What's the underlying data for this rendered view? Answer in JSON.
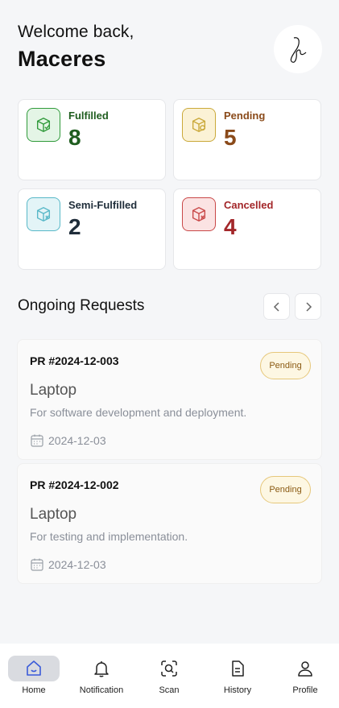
{
  "header": {
    "greeting": "Welcome back,",
    "user_name": "Maceres"
  },
  "stats": [
    {
      "label": "Fulfilled",
      "value": "8",
      "color": "#1f5d1f",
      "icon": "box-check-icon",
      "accent": "#2f9a3a",
      "bg": "#e4f5e6"
    },
    {
      "label": "Pending",
      "value": "5",
      "color": "#8a4a1a",
      "icon": "box-clock-icon",
      "accent": "#caa93a",
      "bg": "#fbf2d6"
    },
    {
      "label": "Semi-Fulfilled",
      "value": "2",
      "color": "#1f2d3a",
      "icon": "box-x-icon",
      "accent": "#58b8c8",
      "bg": "#e3f4f7"
    },
    {
      "label": "Cancelled",
      "value": "4",
      "color": "#a3272a",
      "icon": "box-cancel-icon",
      "accent": "#c94848",
      "bg": "#fbe3e3"
    }
  ],
  "section": {
    "title": "Ongoing Requests"
  },
  "requests": [
    {
      "pr": "PR #2024-12-003",
      "status": "Pending",
      "item": "Laptop",
      "description": "For software development and deployment.",
      "date": "2024-12-03"
    },
    {
      "pr": "PR #2024-12-002",
      "status": "Pending",
      "item": "Laptop",
      "description": "For testing and implementation.",
      "date": "2024-12-03"
    }
  ],
  "nav": [
    {
      "label": "Home",
      "icon": "home-icon",
      "active": true
    },
    {
      "label": "Notification",
      "icon": "bell-icon",
      "active": false
    },
    {
      "label": "Scan",
      "icon": "scan-icon",
      "active": false
    },
    {
      "label": "History",
      "icon": "history-icon",
      "active": false
    },
    {
      "label": "Profile",
      "icon": "profile-icon",
      "active": false
    }
  ]
}
